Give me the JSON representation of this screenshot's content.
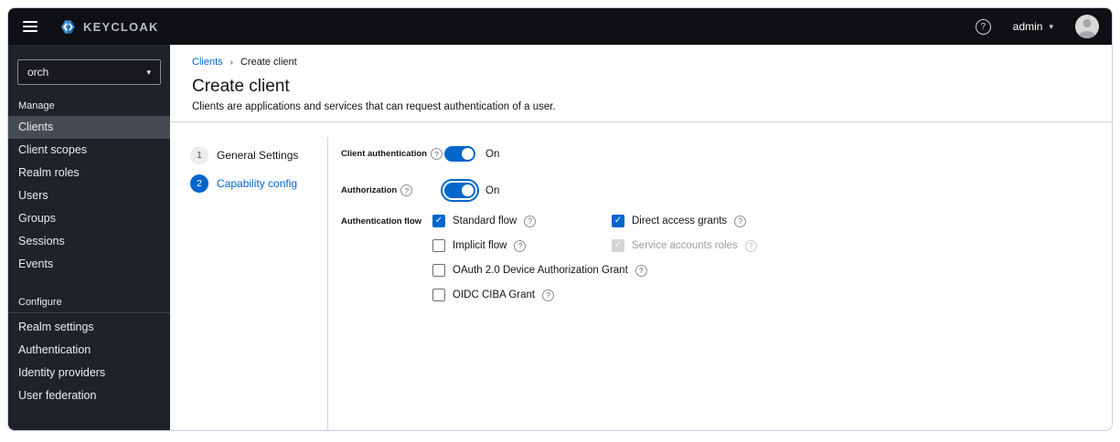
{
  "icons": {
    "help": "?",
    "caret_down": "▾",
    "breadcrumb_separator": "›",
    "check": "✓"
  },
  "colors": {
    "accent": "#0066cc",
    "header_bg": "#0e1013",
    "sidebar_bg": "#1f2226",
    "sidebar_selected": "#464b51"
  },
  "header": {
    "brand": "KEYCLOAK",
    "user": "admin"
  },
  "sidebar": {
    "realm": "orch",
    "sections": [
      {
        "label": "Manage",
        "items": [
          {
            "label": "Clients",
            "selected": "true"
          },
          {
            "label": "Client scopes",
            "selected": "false"
          },
          {
            "label": "Realm roles",
            "selected": "false"
          },
          {
            "label": "Users",
            "selected": "false"
          },
          {
            "label": "Groups",
            "selected": "false"
          },
          {
            "label": "Sessions",
            "selected": "false"
          },
          {
            "label": "Events",
            "selected": "false"
          }
        ]
      },
      {
        "label": "Configure",
        "items": [
          {
            "label": "Realm settings",
            "selected": "false"
          },
          {
            "label": "Authentication",
            "selected": "false"
          },
          {
            "label": "Identity providers",
            "selected": "false"
          },
          {
            "label": "User federation",
            "selected": "false"
          }
        ]
      }
    ]
  },
  "breadcrumb": {
    "items": [
      "Clients",
      "Create client"
    ]
  },
  "page": {
    "title": "Create client",
    "subtitle": "Clients are applications and services that can request authentication of a user."
  },
  "wizard": {
    "steps": [
      {
        "number": "1",
        "label": "General Settings",
        "state": "inactive"
      },
      {
        "number": "2",
        "label": "Capability config",
        "state": "active"
      }
    ]
  },
  "form": {
    "toggles": [
      {
        "label": "Client authentication",
        "value": "On",
        "variant": "on"
      },
      {
        "label": "Authorization",
        "value": "On",
        "variant": "on-focused"
      }
    ],
    "auth_flow": {
      "label": "Authentication flow",
      "options": [
        {
          "label": "Standard flow",
          "state": "checked"
        },
        {
          "label": "Direct access grants",
          "state": "checked"
        },
        {
          "label": "Implicit flow",
          "state": "unchecked"
        },
        {
          "label": "Service accounts roles",
          "state": "checked-disabled"
        },
        {
          "label": "OAuth 2.0 Device Authorization Grant",
          "state": "unchecked"
        },
        {
          "label": "OIDC CIBA Grant",
          "state": "unchecked"
        }
      ]
    }
  }
}
